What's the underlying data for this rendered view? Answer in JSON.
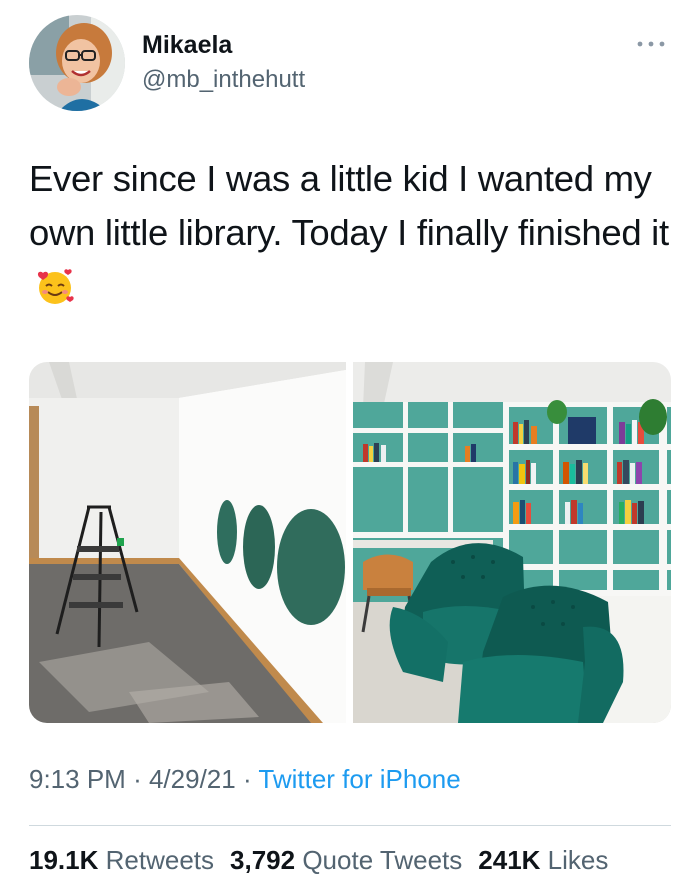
{
  "author": {
    "display_name": "Mikaela",
    "handle": "@mb_inthehutt"
  },
  "tweet": {
    "text": "Ever since I was a little kid I wanted my own little library. Today I finally finished it",
    "emoji": "smiling-face-with-hearts-icon"
  },
  "media": [
    {
      "name": "empty-room-photo"
    },
    {
      "name": "finished-library-photo"
    }
  ],
  "meta": {
    "time": "9:13 PM",
    "sep1": "·",
    "date": "4/29/21",
    "sep2": "·",
    "source": "Twitter for iPhone"
  },
  "stats": {
    "retweets_count": "19.1K",
    "retweets_label": "Retweets",
    "quotes_count": "3,792",
    "quotes_label": "Quote Tweets",
    "likes_count": "241K",
    "likes_label": "Likes"
  },
  "colors": {
    "link": "#1d9bf0",
    "secondary_text": "#536471",
    "primary_text": "#0f1419",
    "accent_teal": "#2e8b7f"
  }
}
